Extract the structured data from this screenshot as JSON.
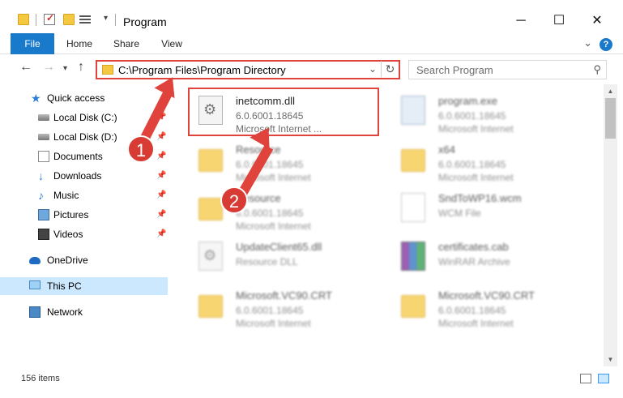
{
  "window": {
    "title": "Program",
    "minimize": "─",
    "maximize": "☐",
    "close": "✕"
  },
  "ribbon": {
    "tabs": [
      "File",
      "Home",
      "Share",
      "View"
    ],
    "help": "?"
  },
  "address": {
    "path": "C:\\Program Files\\Program Directory",
    "search_placeholder": "Search Program"
  },
  "sidebar": {
    "items": [
      {
        "label": "Quick access",
        "icon": "star-icon"
      },
      {
        "label": "Local Disk (C:)",
        "icon": "drive-icon",
        "pinned": true
      },
      {
        "label": "Local Disk (D:)",
        "icon": "drive-icon",
        "pinned": true
      },
      {
        "label": "Documents",
        "icon": "document-icon",
        "pinned": true
      },
      {
        "label": "Downloads",
        "icon": "download-icon",
        "pinned": true
      },
      {
        "label": "Music",
        "icon": "music-icon",
        "pinned": true
      },
      {
        "label": "Pictures",
        "icon": "picture-icon",
        "pinned": true
      },
      {
        "label": "Videos",
        "icon": "video-icon",
        "pinned": true
      },
      {
        "label": "OneDrive",
        "icon": "onedrive-icon"
      },
      {
        "label": "This PC",
        "icon": "computer-icon",
        "selected": true
      },
      {
        "label": "Network",
        "icon": "network-icon"
      }
    ]
  },
  "files": [
    {
      "name": "inetcomm.dll",
      "line1": "6.0.6001.18645",
      "line2": "Microsoft Internet ...",
      "icon": "dll-file-icon",
      "highlighted": true
    },
    {
      "name": "program.exe",
      "line1": "6.0.6001.18645",
      "line2": "Microsoft Internet",
      "icon": "exe-file-icon"
    },
    {
      "name": "Resource",
      "line1": "6.0.6001.18645",
      "line2": "Microsoft Internet",
      "icon": "folder-icon"
    },
    {
      "name": "x64",
      "line1": "6.0.6001.18645",
      "line2": "Microsoft Internet",
      "icon": "folder-icon"
    },
    {
      "name": "Resource",
      "line1": "6.0.6001.18645",
      "line2": "Microsoft Internet",
      "icon": "folder-icon"
    },
    {
      "name": "SndToWP16.wcm",
      "line1": "WCM File",
      "line2": "",
      "icon": "document-file-icon"
    },
    {
      "name": "UpdateClient65.dll",
      "line1": "Resource DLL",
      "line2": "",
      "icon": "dll-file-icon"
    },
    {
      "name": "certificates.cab",
      "line1": "WinRAR Archive",
      "line2": "",
      "icon": "cab-file-icon"
    },
    {
      "name": "Microsoft.VC90.CRT",
      "line1": "6.0.6001.18645",
      "line2": "Microsoft Internet",
      "icon": "folder-icon"
    },
    {
      "name": "Microsoft.VC90.CRT",
      "line1": "6.0.6001.18645",
      "line2": "Microsoft Internet",
      "icon": "folder-icon"
    }
  ],
  "status": {
    "item_count": "156 items"
  },
  "annotations": {
    "step1": "1",
    "step2": "2",
    "color": "#e0433b"
  }
}
